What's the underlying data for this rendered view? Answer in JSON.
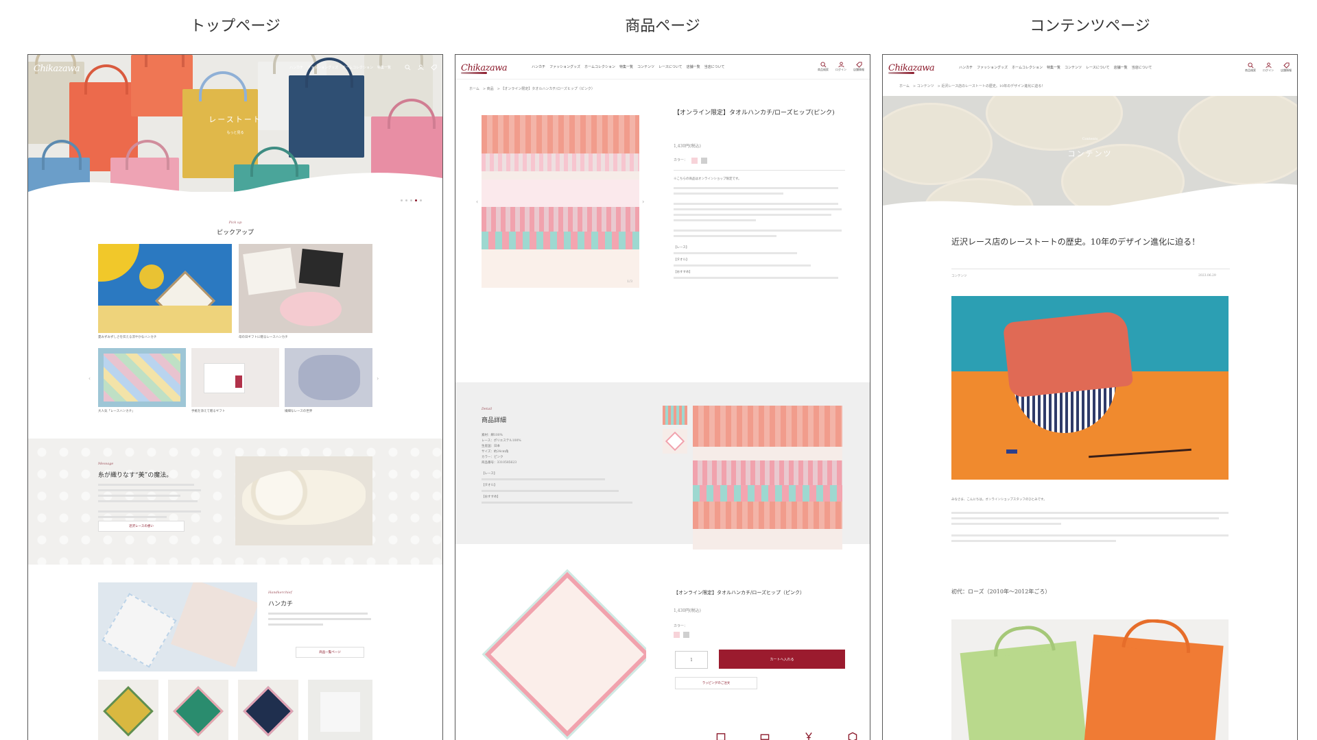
{
  "headings": {
    "top": "トップページ",
    "product": "商品ページ",
    "content": "コンテンツページ"
  },
  "brand": {
    "logo": "Chikazawa",
    "accent": "#8b1a2b"
  },
  "header": {
    "nav": [
      "ハンカチ",
      "ファッショングッズ",
      "ホームコレクション",
      "特集一覧",
      "コンテンツ",
      "レースについて",
      "店舗一覧",
      "当店について"
    ],
    "icons": [
      {
        "icon": "search-icon",
        "label": "商品検索"
      },
      {
        "icon": "user-icon",
        "label": "ログイン"
      },
      {
        "icon": "tag-icon",
        "label": "店舗情報"
      }
    ]
  },
  "top": {
    "hero_text": "レーストート",
    "hero_sub": "もっと見る",
    "pickup_en": "Pick up",
    "pickup_jp": "ピックアップ",
    "pickup_caps": [
      "夏みずみずしさを伝える涼やかなハンカチ",
      "母の日ギフトに贈るレースハンカチ",
      "大人気「レースハンカチ」",
      "手紙を添えて贈るギフト",
      "繊細なレースの世界"
    ],
    "story_en": "Message",
    "story_title": "糸が織りなす“美”の魔法。",
    "story_link": "近沢レースの想い",
    "hanky_en": "Handkerchief",
    "hanky_title": "ハンカチ",
    "hanky_link": "商品一覧ページ"
  },
  "product": {
    "breadcrumb": "ホーム　> 商品　> 【オンライン限定】タオルハンカチ/ローズヒップ（ピンク）",
    "title": "【オンライン限定】タオルハンカチ/ローズヒップ(ピンク)",
    "price": "1,430円(税込)",
    "color_label": "カラー：",
    "description": "※こちらの商品はオンラインショップ限定です。",
    "counter": "1/3",
    "detail_en": "Detail",
    "detail_title": "商品詳細",
    "specs": [
      "素材：綿100%",
      "レース：ポリエステル100%",
      "生産国：日本",
      "サイズ：約24cm角",
      "カラー：ピンク",
      "商品番号：3310585623"
    ],
    "notes": [
      "【レース】",
      "【タオル】",
      "【おすすめ】"
    ],
    "bottom_title": "【オンライン限定】タオルハンカチ/ローズヒップ（ピンク）",
    "qty": "1",
    "cart_button": "カートへ入れる",
    "fav_button": "ラッピングのご注文"
  },
  "content": {
    "breadcrumb": "ホーム　> コンテンツ　> 近沢レース店のレーストートの歴史。10年のデザイン進化に迫る！",
    "hero_en": "Contents",
    "hero_jp": "コンテンツ",
    "article_title": "近沢レース店のレーストートの歴史。10年のデザイン進化に迫る！",
    "category": "コンテンツ",
    "date": "2023.06.29",
    "intro": "みなさま、こんにちは。オンラインショップスタッフのひとみです。",
    "subhead": "初代：ローズ（2010年〜2012年ごろ）"
  }
}
